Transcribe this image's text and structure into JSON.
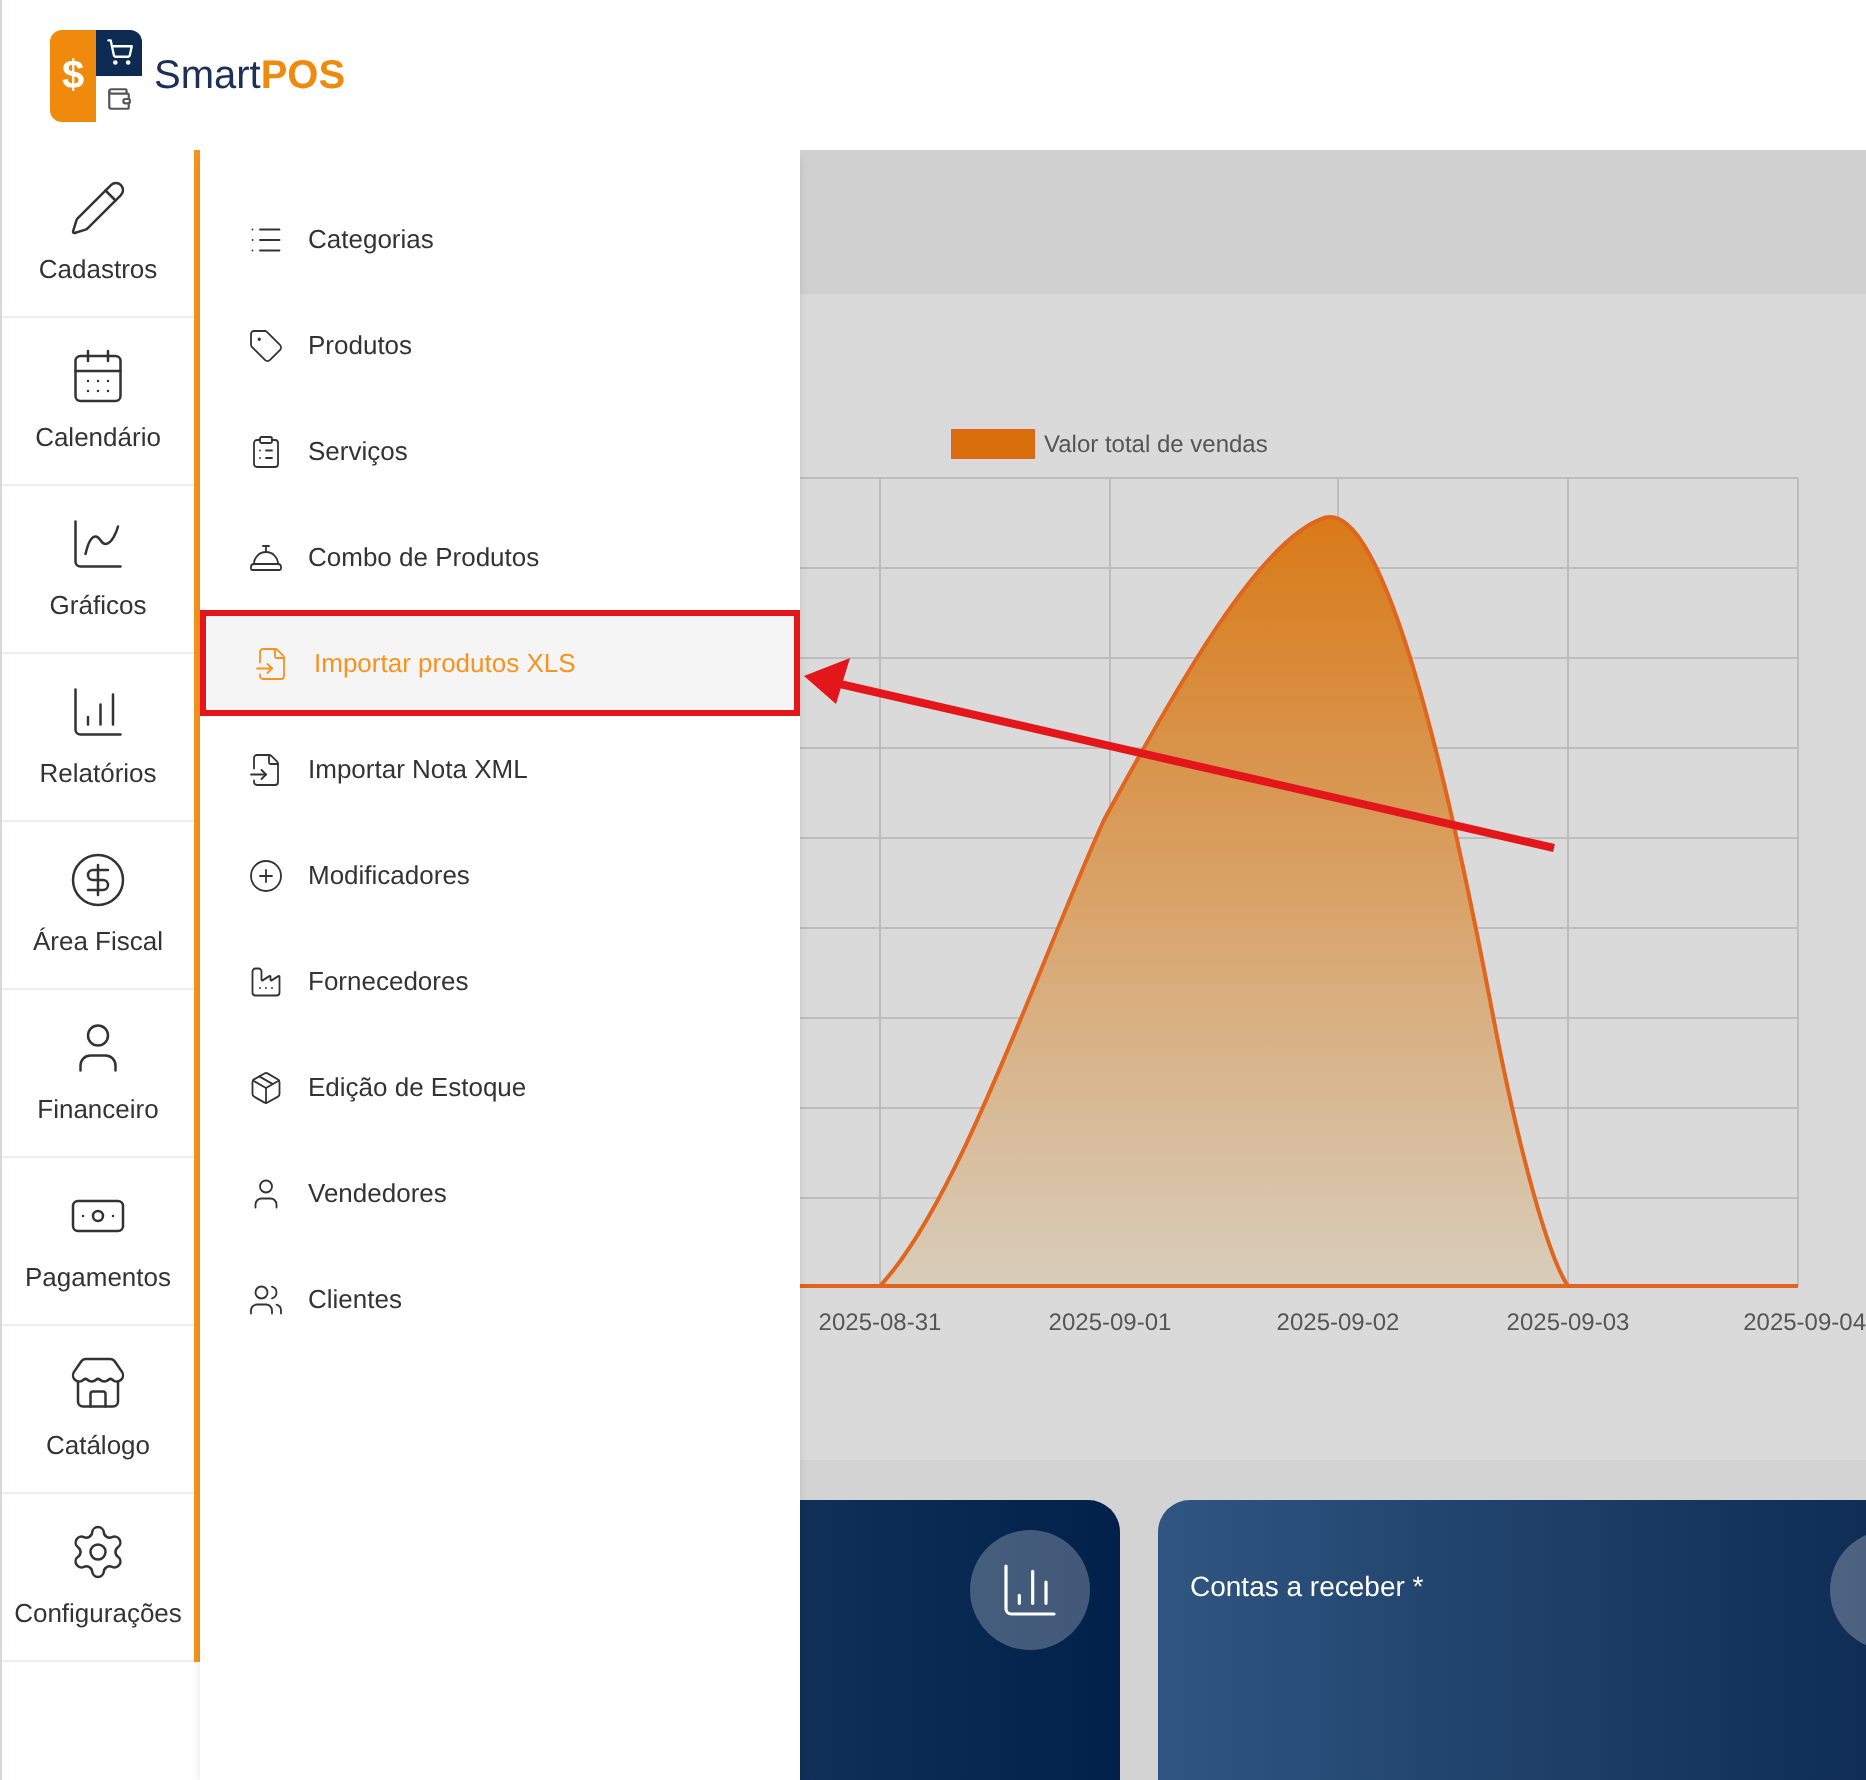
{
  "header": {
    "logo": {
      "symbol": "$",
      "word": "Smart",
      "word_accent": "POS"
    }
  },
  "sidebar": {
    "items": [
      {
        "label": "Cadastros"
      },
      {
        "label": "Calendário"
      },
      {
        "label": "Gráficos"
      },
      {
        "label": "Relatórios"
      },
      {
        "label": "Área Fiscal"
      },
      {
        "label": "Financeiro"
      },
      {
        "label": "Pagamentos"
      },
      {
        "label": "Catálogo"
      },
      {
        "label": "Configurações"
      }
    ]
  },
  "submenu": {
    "items": [
      {
        "label": "Categorias",
        "selected": false
      },
      {
        "label": "Produtos",
        "selected": false
      },
      {
        "label": "Serviços",
        "selected": false
      },
      {
        "label": "Combo de Produtos",
        "selected": false
      },
      {
        "label": "Importar produtos XLS",
        "selected": true
      },
      {
        "label": "Importar Nota XML",
        "selected": false
      },
      {
        "label": "Modificadores",
        "selected": false
      },
      {
        "label": "Fornecedores",
        "selected": false
      },
      {
        "label": "Edição de Estoque",
        "selected": false
      },
      {
        "label": "Vendedores",
        "selected": false
      },
      {
        "label": "Clientes",
        "selected": false
      }
    ]
  },
  "chart": {
    "legend": "Valor total de vendas",
    "x_labels": [
      "2025-08-31",
      "2025-09-01",
      "2025-09-02",
      "2025-09-03",
      "2025-09-04"
    ]
  },
  "cards": [
    {
      "title": "Contas a receber *"
    }
  ]
}
